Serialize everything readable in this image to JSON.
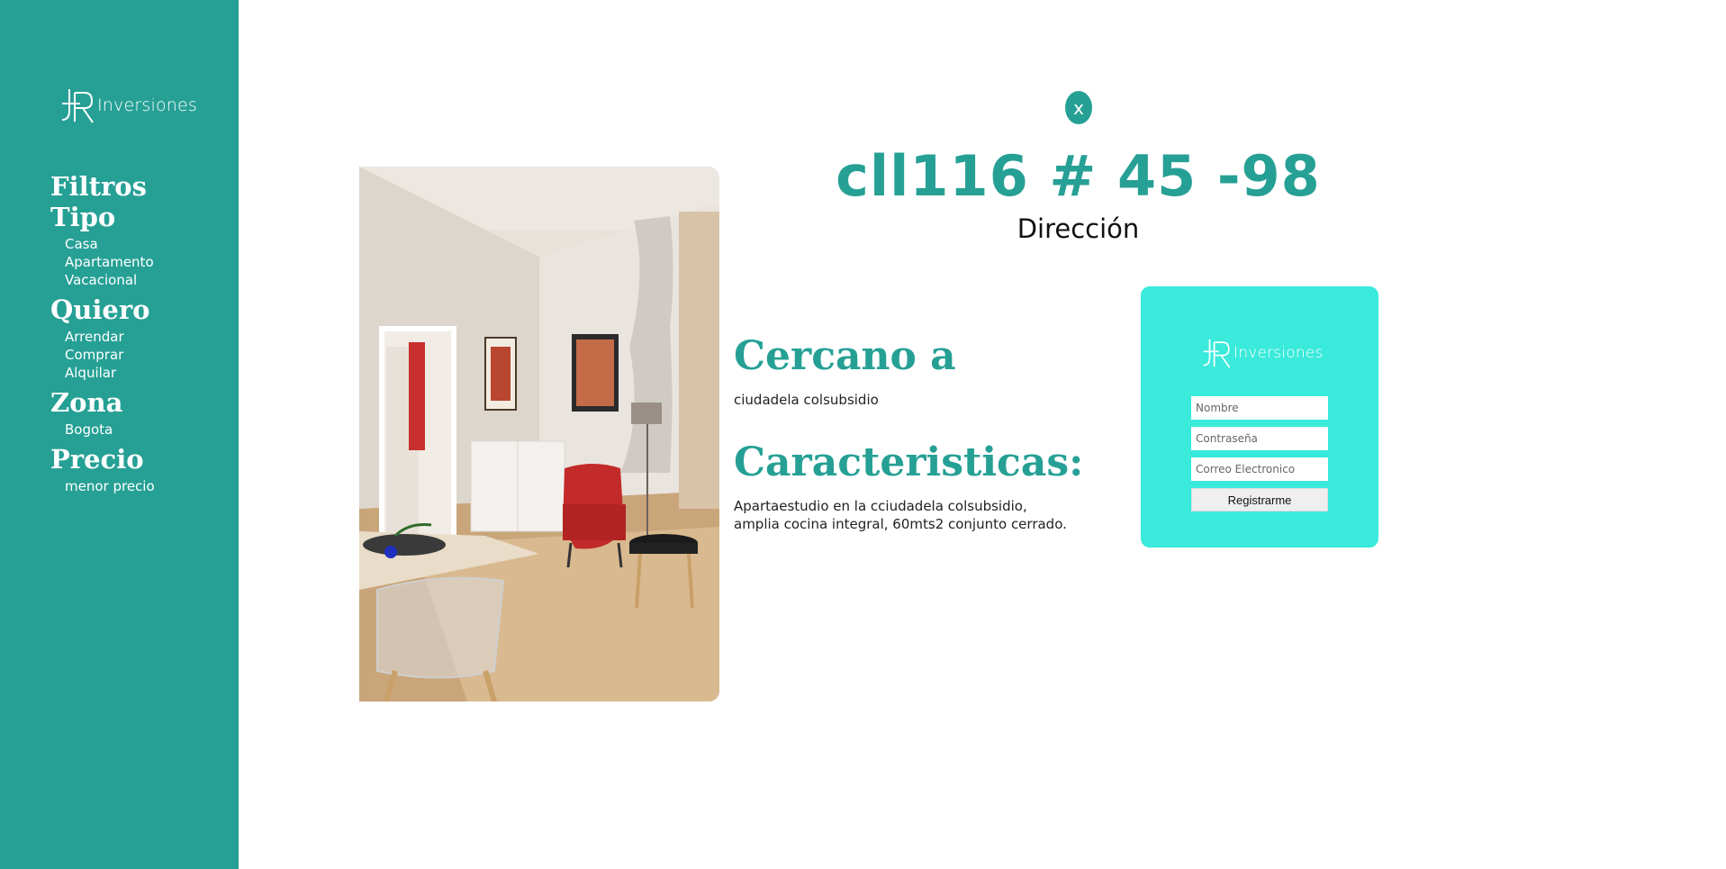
{
  "brand": {
    "name": "Inversiones",
    "mark": "JR"
  },
  "sidebar": {
    "sections": [
      {
        "title": "Filtros",
        "items": []
      },
      {
        "title": "Tipo",
        "items": [
          "Casa",
          "Apartamento",
          "Vacacional"
        ]
      },
      {
        "title": "Quiero",
        "items": [
          "Arrendar",
          "Comprar",
          "Alquilar"
        ]
      },
      {
        "title": "Zona",
        "items": [
          "Bogota"
        ]
      },
      {
        "title": "Precio",
        "items": [
          "menor precio"
        ]
      }
    ]
  },
  "detail": {
    "close_label": "x",
    "address": "cll116 # 45 -98",
    "address_label": "Dirección",
    "near_title": "Cercano a",
    "near_text": "ciudadela colsubsidio",
    "features_title": "Caracteristicas:",
    "features_text": "Apartaestudio en la cciudadela colsubsidio, amplia cocina integral, 60mts2 conjunto cerrado."
  },
  "register": {
    "name_placeholder": "Nombre",
    "password_placeholder": "Contraseña",
    "email_placeholder": "Correo Electronico",
    "button_label": "Registrarme"
  },
  "colors": {
    "primary": "#26a095",
    "register_panel": "#3aeadb",
    "background": "#ffffff"
  }
}
